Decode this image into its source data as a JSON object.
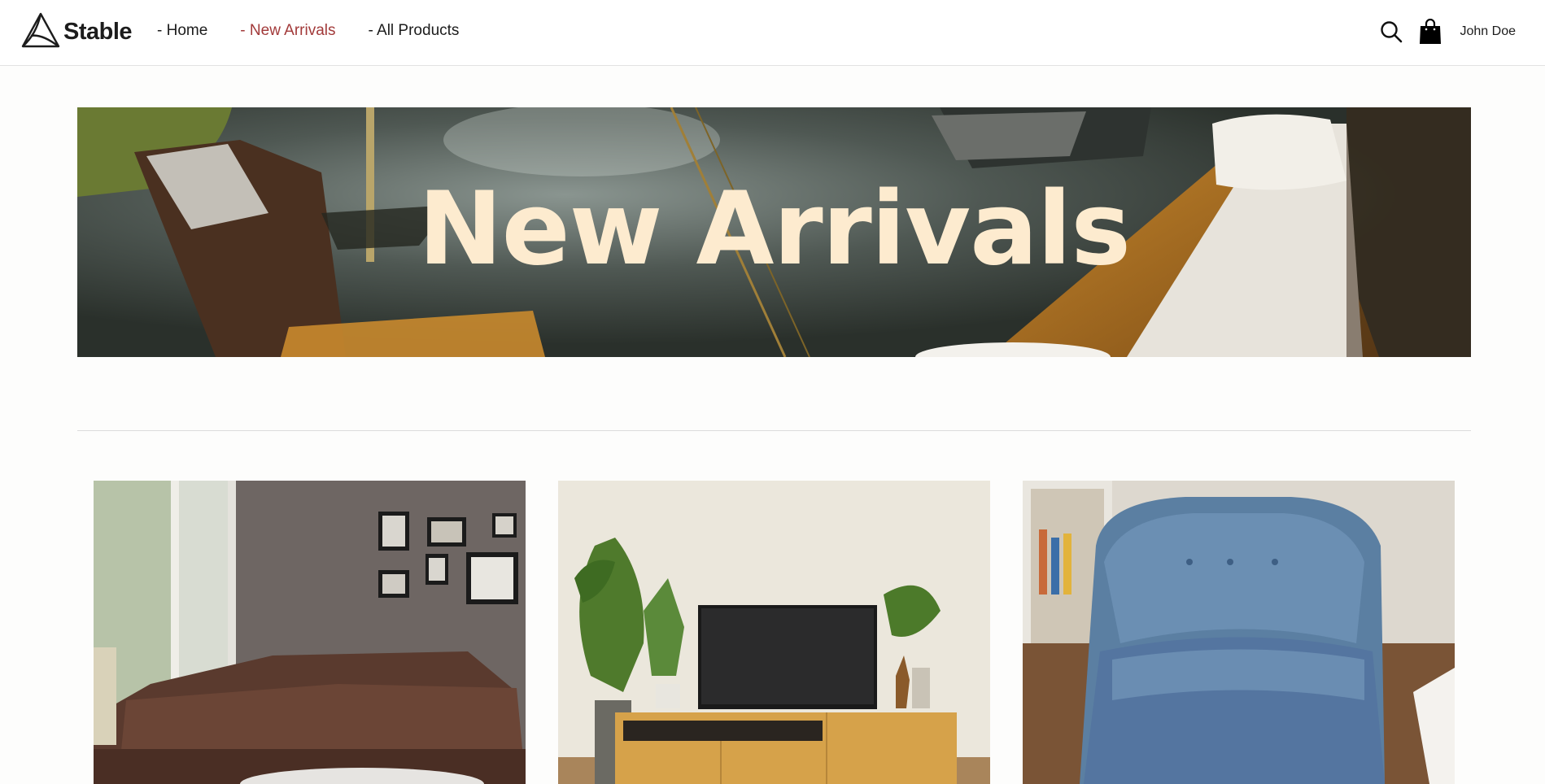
{
  "brand": {
    "name": "Stable",
    "logo_icon": "triangle-knot-logo"
  },
  "nav": {
    "items": [
      {
        "label": "- Home",
        "active": false
      },
      {
        "label": "- New Arrivals",
        "active": true
      },
      {
        "label": "- All Products",
        "active": false
      }
    ],
    "active_color": "#a23a3a"
  },
  "header": {
    "search_icon": "search-icon",
    "bag_icon": "shopping-bag-icon",
    "user_name": "John Doe"
  },
  "hero": {
    "title": "New Arrivals",
    "title_color": "#fdebcf"
  },
  "products": [
    {
      "image": "brown-leather-sectional-sofa"
    },
    {
      "image": "wooden-tv-console-with-plants"
    },
    {
      "image": "blue-upholstered-armchair"
    }
  ]
}
